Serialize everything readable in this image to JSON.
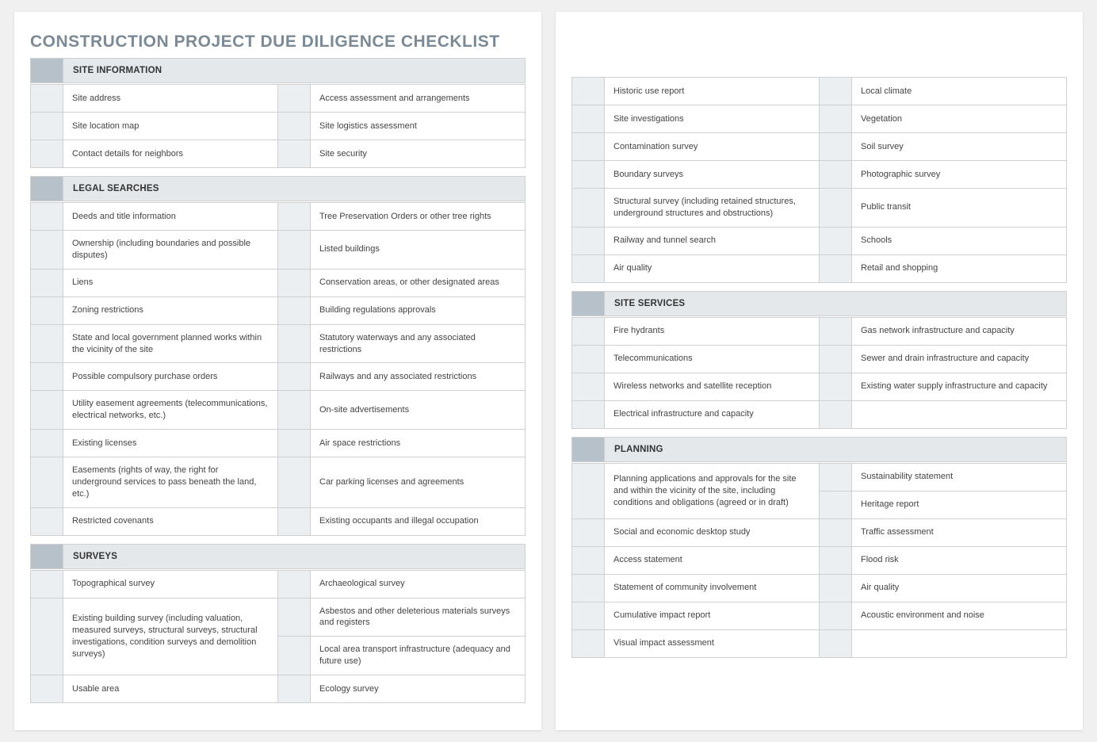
{
  "title": "CONSTRUCTION PROJECT DUE DILIGENCE CHECKLIST",
  "sections": {
    "site_info": {
      "header": "SITE INFORMATION",
      "rows": [
        [
          "Site address",
          "Access assessment and arrangements"
        ],
        [
          "Site location map",
          "Site logistics assessment"
        ],
        [
          "Contact details for neighbors",
          "Site security"
        ]
      ]
    },
    "legal": {
      "header": "LEGAL SEARCHES",
      "rows": [
        [
          "Deeds and title information",
          "Tree Preservation Orders or other tree rights"
        ],
        [
          "Ownership (including boundaries and possible disputes)",
          "Listed buildings"
        ],
        [
          "Liens",
          "Conservation areas, or other designated areas"
        ],
        [
          "Zoning restrictions",
          "Building regulations approvals"
        ],
        [
          "State and local government planned works within the vicinity of the site",
          "Statutory waterways and any associated restrictions"
        ],
        [
          "Possible compulsory purchase orders",
          "Railways and any associated restrictions"
        ],
        [
          "Utility easement agreements (telecommunications, electrical networks, etc.)",
          "On-site advertisements"
        ],
        [
          "Existing licenses",
          "Air space restrictions"
        ],
        [
          "Easements (rights of way, the right for underground services to pass beneath the land, etc.)",
          "Car parking licenses and agreements"
        ],
        [
          "Restricted covenants",
          "Existing occupants and illegal occupation"
        ]
      ]
    },
    "surveys": {
      "header": "SURVEYS",
      "rows_left_page1": [
        {
          "left": "Topographical survey",
          "right": "Archaeological survey",
          "left_span": 1
        },
        {
          "left": "Existing building survey (including valuation, measured surveys, structural surveys, structural investigations, condition surveys and demolition surveys)",
          "right": [
            "Asbestos and other deleterious materials surveys and registers",
            "Local area transport infrastructure (adequacy and future use)"
          ],
          "left_span": 2
        },
        {
          "left": "Usable area",
          "right": "Ecology survey",
          "left_span": 1
        }
      ],
      "rows_page2": [
        [
          "Historic use report",
          "Local climate"
        ],
        [
          "Site investigations",
          "Vegetation"
        ],
        [
          "Contamination survey",
          "Soil survey"
        ],
        [
          "Boundary surveys",
          "Photographic survey"
        ],
        [
          "Structural survey (including retained structures, underground structures and obstructions)",
          "Public transit"
        ],
        [
          "Railway and tunnel search",
          "Schools"
        ],
        [
          "Air quality",
          "Retail and shopping"
        ]
      ]
    },
    "site_services": {
      "header": "SITE SERVICES",
      "rows": [
        [
          "Fire hydrants",
          "Gas network infrastructure and capacity"
        ],
        [
          "Telecommunications",
          "Sewer and drain infrastructure and capacity"
        ],
        [
          "Wireless networks and satellite reception",
          "Existing water supply infrastructure and capacity"
        ],
        [
          "Electrical infrastructure and capacity",
          ""
        ]
      ]
    },
    "planning": {
      "header": "PLANNING",
      "rows_special": {
        "first_left": "Planning applications and approvals for the site and within the vicinity of the site, including conditions and obligations (agreed or in draft)",
        "first_right": [
          "Sustainability statement",
          "Heritage report"
        ]
      },
      "rows": [
        [
          "Social and economic desktop study",
          "Traffic assessment"
        ],
        [
          "Access statement",
          "Flood risk"
        ],
        [
          "Statement of community involvement",
          "Air quality"
        ],
        [
          "Cumulative impact report",
          "Acoustic environment and noise"
        ],
        [
          "Visual impact assessment",
          ""
        ]
      ]
    }
  }
}
